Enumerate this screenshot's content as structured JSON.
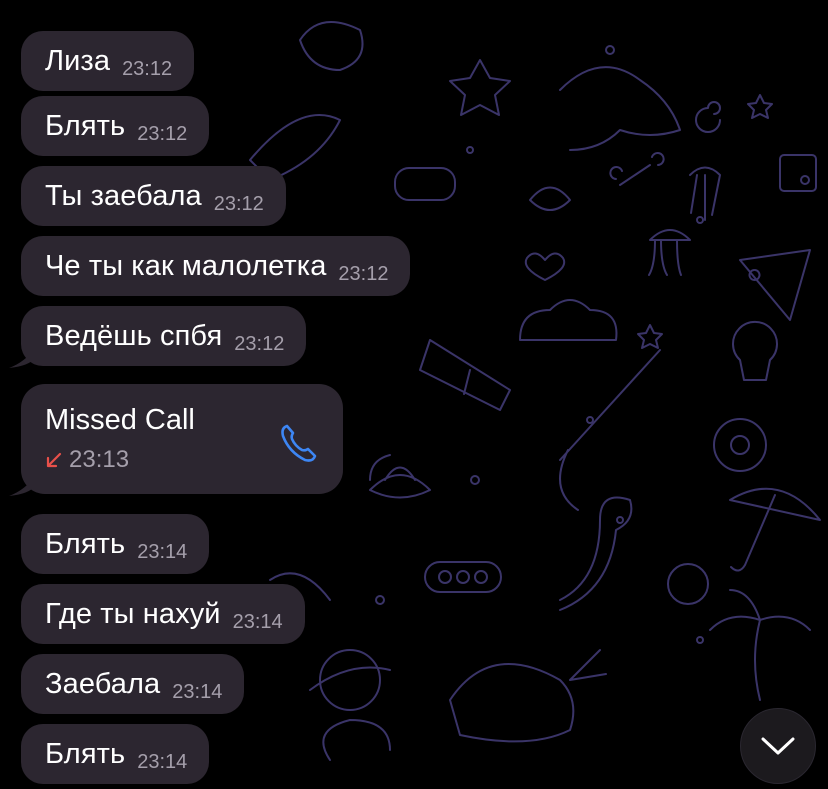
{
  "messages": [
    {
      "text": "Лиза",
      "time": "23:12"
    },
    {
      "text": "Блять",
      "time": "23:12"
    },
    {
      "text": "Ты заебала",
      "time": "23:12"
    },
    {
      "text": "Че ты как малолетка",
      "time": "23:12"
    },
    {
      "text": "Ведёшь спбя",
      "time": "23:12"
    },
    {
      "text": "Блять",
      "time": "23:14"
    },
    {
      "text": "Где ты нахуй",
      "time": "23:14"
    },
    {
      "text": "Заебала",
      "time": "23:14"
    },
    {
      "text": "Блять",
      "time": "23:14"
    }
  ],
  "call": {
    "title": "Missed Call",
    "time": "23:13",
    "direction_icon": "missed-call-arrow-icon",
    "action_icon": "phone-icon"
  },
  "scroll_button": {
    "icon": "chevron-down-icon"
  },
  "colors": {
    "background": "#000000",
    "bubble": "#2c2630",
    "text": "#ffffff",
    "timestamp": "#a59fab",
    "missed_arrow": "#e8504a",
    "phone_icon": "#3d86f4",
    "wallpaper_lines": "#3a3468"
  }
}
